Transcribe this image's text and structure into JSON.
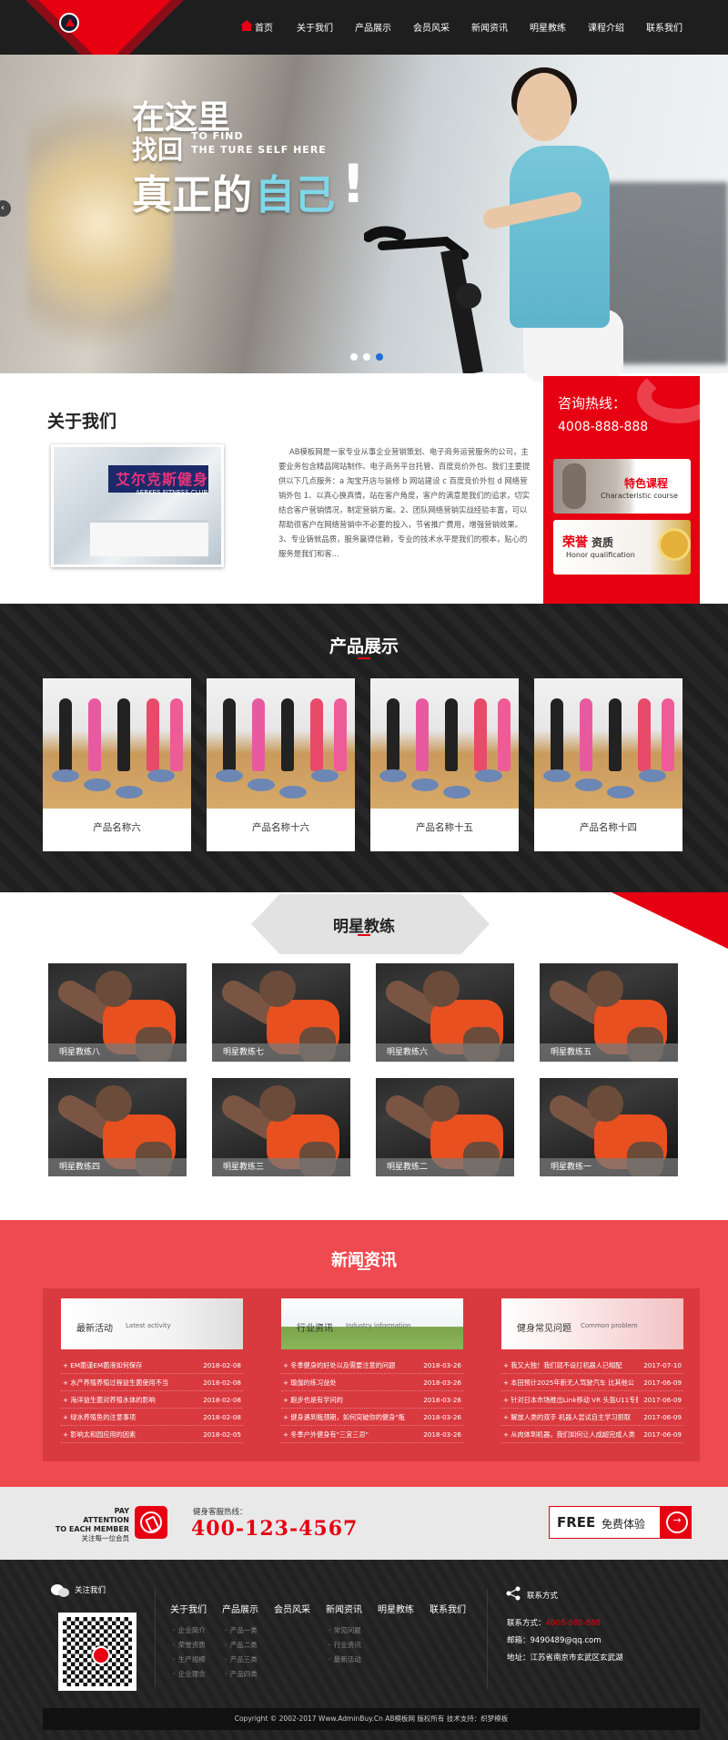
{
  "nav": {
    "items": [
      {
        "label": "首页",
        "icon": "home-icon"
      },
      {
        "label": "关于我们"
      },
      {
        "label": "产品展示"
      },
      {
        "label": "会员风采"
      },
      {
        "label": "新闻资讯"
      },
      {
        "label": "明星教练"
      },
      {
        "label": "课程介绍"
      },
      {
        "label": "联系我们"
      }
    ]
  },
  "hero": {
    "line1": "在这里",
    "line2": "找回",
    "line2_en1": "TO FIND",
    "line2_en2": "THE TURE SELF HERE",
    "line3a": "真正的",
    "line3b": "自己",
    "exclaim": "!"
  },
  "about": {
    "title": "关于我们",
    "image_sign": "艾尔克斯健身",
    "image_sign_en": "AERKES FITNESS CLUB",
    "text": "AB模板网是一家专业从事企业营销策划、电子商务运营服务的公司，主要业务包含精品网站制作、电子商务平台托管、百度竞价外包。我们主要提供以下几点服务：a 淘宝开店与装修 b 网站建设 c 百度竞价外包 d 网络营销外包 1、以真心换真情，站在客户角度，客户的满意是我们的追求，切实结合客户营销情况，制定营销方案。2、团队网络营销实战经验丰富，可以帮助很客户在网络营销中不必要的投入，节省推广费用，增强营销效果。3、专业铸就品质，服务赢得信赖，专业的技术水平是我们的根本，贴心的服务是我们和客..."
  },
  "sidebar": {
    "hotline_label": "咨询热线：",
    "hotline_number": "4008-888-888",
    "card1_title": "特色课程",
    "card1_sub": "Characteristic  course",
    "card2_title_red": "荣誉",
    "card2_title_dark": "资质",
    "card2_sub": "Honor qualification"
  },
  "products": {
    "title": "产品展示",
    "items": [
      "产品名称六",
      "产品名称十六",
      "产品名称十五",
      "产品名称十四"
    ]
  },
  "coaches": {
    "title": "明星教练",
    "items": [
      "明星教练八",
      "明星教练七",
      "明星教练六",
      "明星教练五",
      "明星教练四",
      "明星教练三",
      "明星教练二",
      "明星教练一"
    ]
  },
  "news": {
    "title": "新闻资讯",
    "columns": [
      {
        "head": "最新活动",
        "head_en": "Latest activity",
        "rows": [
          {
            "t": "+ EM菌谨EM菌液如何保存",
            "d": "2018-02-08"
          },
          {
            "t": "+ 水产养殖养殖过程益生菌使用不当",
            "d": "2018-02-08"
          },
          {
            "t": "+ 海洋益生菌对养殖水体的影响",
            "d": "2018-02-08"
          },
          {
            "t": "+ 绿水养殖鱼的注意事项",
            "d": "2018-02-08"
          },
          {
            "t": "+ 影响太和园应用的因素",
            "d": "2018-02-05"
          }
        ]
      },
      {
        "head": "行业资讯",
        "head_en": "Industry information",
        "rows": [
          {
            "t": "+ 冬季健身的好处以及需要注意的问题",
            "d": "2018-03-26"
          },
          {
            "t": "+ 瑜伽的练习益处",
            "d": "2018-03-26"
          },
          {
            "t": "+ 跑步也是有学问的",
            "d": "2018-03-26"
          },
          {
            "t": "+ 健身遇到瓶颈期，如何突破你的健身\"瓶",
            "d": "2018-03-26"
          },
          {
            "t": "+ 冬季户外健身有\"三宜三忌\"",
            "d": "2018-03-26"
          }
        ]
      },
      {
        "head": "健身常见问题",
        "head_en": "Common problem",
        "rows": [
          {
            "t": "+ 我又大独！我们就不设打机器人已帽配",
            "d": "2017-07-10"
          },
          {
            "t": "+ 本田预计2025年新无人驾驶汽车 比其他公",
            "d": "2017-06-09"
          },
          {
            "t": "+ 针对日本市场推出Link移动 VR 头盔U11专版",
            "d": "2017-06-09"
          },
          {
            "t": "+ 解放人类的双手 机器人尝试自主学习抓取",
            "d": "2017-06-09"
          },
          {
            "t": "+ 从肉体到机器，我们如何让人成超完成人类",
            "d": "2017-06-09"
          }
        ]
      }
    ]
  },
  "cta": {
    "pay1": "PAY",
    "pay2": "ATTENTION",
    "pay3": "TO EACH MEMBER",
    "pay_cn": "关注每一位会员",
    "tel_label": "健身客服热线：",
    "tel_number": "400-123-4567",
    "free_label": "FREE",
    "free_cn": "免费体验"
  },
  "footer": {
    "follow": "关注我们",
    "nav": [
      "关于我们",
      "产品展示",
      "会员风采",
      "新闻资讯",
      "明星教练",
      "联系我们"
    ],
    "sub_about": [
      "◦ 企业简介",
      "◦ 荣誉资质",
      "◦ 生产规模",
      "◦ 企业理念"
    ],
    "sub_products": [
      "◦ 产品一类",
      "◦ 产品二类",
      "◦ 产品三类",
      "◦ 产品四类"
    ],
    "sub_news": [
      "◦ 常见问题",
      "◦ 行业资讯",
      "◦ 最新活动"
    ],
    "contact_head": "联系方式",
    "phone_label": "联系方式：",
    "phone": "4008-888-888",
    "email": "邮箱：9490489@qq.com",
    "address": "地址：江苏省南京市玄武区玄武湖",
    "copyright": "Copyright © 2002-2017 Www.AdminBuy.Cn AB模板网 版权所有 技术支持：织梦模板"
  }
}
